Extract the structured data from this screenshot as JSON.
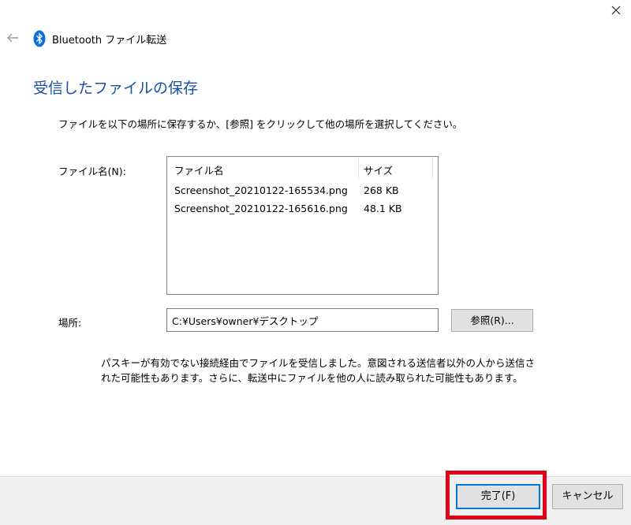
{
  "window": {
    "title": "Bluetooth ファイル転送",
    "back_icon": "back-arrow-icon",
    "app_icon": "bluetooth-icon",
    "close_icon": "close-icon"
  },
  "main": {
    "heading": "受信したファイルの保存",
    "instruction": "ファイルを以下の場所に保存するか、[参照] をクリックして他の場所を選択してください。",
    "filename_label": "ファイル名(N):",
    "file_list": {
      "columns": [
        "ファイル名",
        "サイズ"
      ],
      "rows": [
        {
          "name": "Screenshot_20210122-165534.png",
          "size": "268 KB"
        },
        {
          "name": "Screenshot_20210122-165616.png",
          "size": "48.1 KB"
        }
      ]
    },
    "location_label": "場所:",
    "location_value": "C:¥Users¥owner¥デスクトップ",
    "browse_label": "参照(R)...",
    "warning_line1": "パスキーが有効でない接続経由でファイルを受信しました。意図される送信者以外の人から送信さ",
    "warning_line2": "れた可能性もあります。さらに、転送中にファイルを他の人に読み取られた可能性もあります。"
  },
  "footer": {
    "finish_label": "完了(F)",
    "cancel_label": "キャンセル"
  },
  "colors": {
    "heading": "#1a4fa3",
    "highlight": "#e0001a",
    "bluetooth": "#0a6fd8"
  }
}
